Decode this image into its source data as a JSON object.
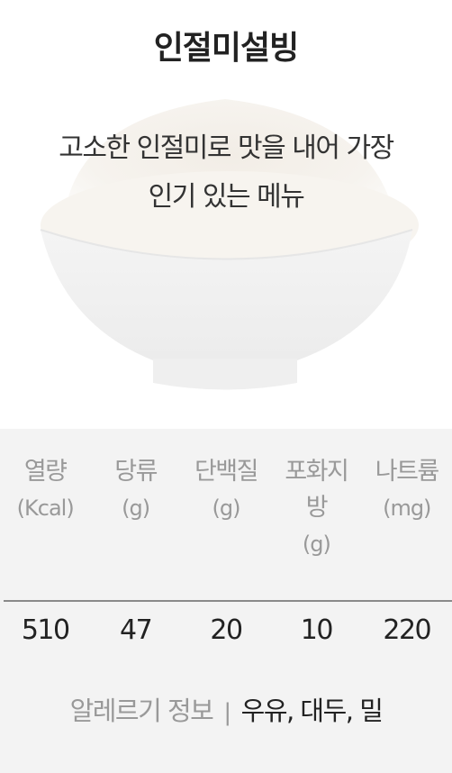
{
  "menu": {
    "title": "인절미설빙",
    "description_line1": "고소한 인절미로 맛을 내어 가장",
    "description_line2": "인기 있는 메뉴"
  },
  "nutrition": {
    "columns": [
      {
        "label": "열량",
        "label2": "",
        "unit": "(Kcal)",
        "value": "510"
      },
      {
        "label": "당류",
        "label2": "",
        "unit": "(g)",
        "value": "47"
      },
      {
        "label": "단백질",
        "label2": "",
        "unit": "(g)",
        "value": "20"
      },
      {
        "label": "포화지",
        "label2": "방",
        "unit": "(g)",
        "value": "10"
      },
      {
        "label": "나트륨",
        "label2": "",
        "unit": "(mg)",
        "value": "220"
      }
    ]
  },
  "allergy": {
    "label": "알레르기 정보",
    "separator": "|",
    "items": "우유, 대두, 밀"
  },
  "image": {
    "subject": "bowl-of-bingsu-photo"
  }
}
